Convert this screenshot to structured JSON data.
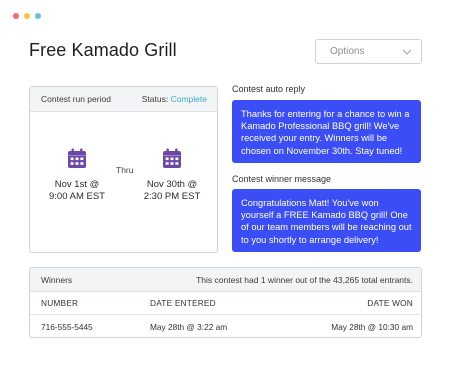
{
  "window": {
    "dot_colors": [
      "#f26b6b",
      "#f5c14e",
      "#5cc8d8"
    ]
  },
  "header": {
    "title": "Free Kamado Grill",
    "options_label": "Options"
  },
  "run_period": {
    "title": "Contest run period",
    "status_label": "Status:",
    "status_value": "Complete",
    "status_color": "#3aaac8",
    "start": {
      "date": "Nov 1st @",
      "time": "9:00 AM EST"
    },
    "thru": "Thru",
    "end": {
      "date": "Nov 30th @",
      "time": "2:30 PM EST"
    },
    "calendar_icon_color": "#6c47a8"
  },
  "auto_reply": {
    "label": "Contest auto reply",
    "message": "Thanks for entering for a chance to win a Kamado Professional BBQ grill! We've received your entry. Winners will be chosen on November 30th. Stay tuned!"
  },
  "winner_message": {
    "label": "Contest winner message",
    "message": "Congratulations Matt! You've won yourself a FREE Kamado BBQ grill! One of our team members will be reaching out to you shortly to arrange delivery!"
  },
  "bubble_color": "#3b4ef5",
  "winners": {
    "title": "Winners",
    "summary": "This contest had 1 winner out of the 43,265 total entrants.",
    "columns": [
      "NUMBER",
      "DATE ENTERED",
      "DATE WON"
    ],
    "rows": [
      {
        "number": "716-555-5445",
        "date_entered": "May 28th @ 3:22 am",
        "date_won": "May 28th @ 10:30 am"
      }
    ]
  }
}
